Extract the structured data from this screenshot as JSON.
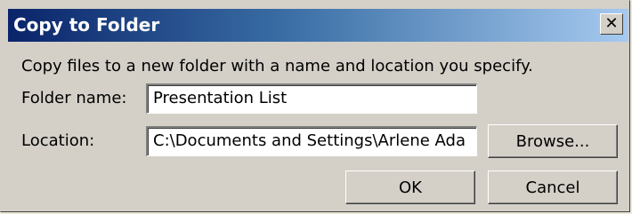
{
  "window": {
    "title": "Copy to Folder",
    "close_icon": "close-icon"
  },
  "dialog": {
    "description": "Copy files to a new folder with a name and location you specify.",
    "folder_name_label": "Folder name:",
    "folder_name_value": "Presentation List",
    "location_label": "Location:",
    "location_value": "C:\\Documents and Settings\\Arlene Ada",
    "browse_label": "Browse...",
    "ok_label": "OK",
    "cancel_label": "Cancel"
  }
}
